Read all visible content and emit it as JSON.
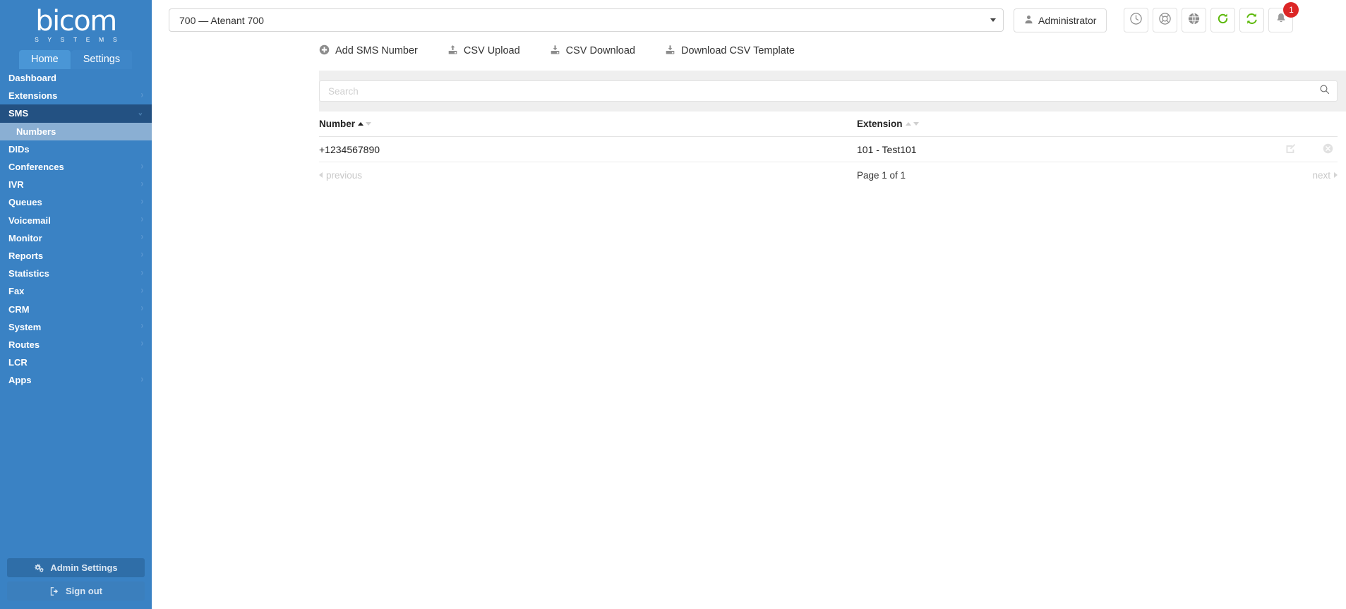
{
  "brand": {
    "logo_word": "bicom",
    "logo_sub": "S Y S T E M S",
    "sidebar_color": "#3a82c4",
    "accent_color": "#235182",
    "badge_color": "#dc2626",
    "refresh_green": "#5cb80a"
  },
  "tabs": [
    {
      "label": "Home",
      "active": true
    },
    {
      "label": "Settings",
      "active": false
    }
  ],
  "sidebar": {
    "items": [
      {
        "label": "Dashboard",
        "chevron": false,
        "state": "normal"
      },
      {
        "label": "Extensions",
        "chevron": true,
        "state": "normal"
      },
      {
        "label": "SMS",
        "chevron": true,
        "state": "expanded"
      },
      {
        "label": "Numbers",
        "chevron": false,
        "state": "sub-selected"
      },
      {
        "label": "DIDs",
        "chevron": false,
        "state": "normal"
      },
      {
        "label": "Conferences",
        "chevron": true,
        "state": "normal"
      },
      {
        "label": "IVR",
        "chevron": true,
        "state": "normal"
      },
      {
        "label": "Queues",
        "chevron": true,
        "state": "normal"
      },
      {
        "label": "Voicemail",
        "chevron": true,
        "state": "normal"
      },
      {
        "label": "Monitor",
        "chevron": true,
        "state": "normal"
      },
      {
        "label": "Reports",
        "chevron": true,
        "state": "normal"
      },
      {
        "label": "Statistics",
        "chevron": true,
        "state": "normal"
      },
      {
        "label": "Fax",
        "chevron": true,
        "state": "normal"
      },
      {
        "label": "CRM",
        "chevron": true,
        "state": "normal"
      },
      {
        "label": "System",
        "chevron": true,
        "state": "normal"
      },
      {
        "label": "Routes",
        "chevron": true,
        "state": "normal"
      },
      {
        "label": "LCR",
        "chevron": false,
        "state": "normal"
      },
      {
        "label": "Apps",
        "chevron": true,
        "state": "normal"
      }
    ],
    "admin_settings_label": "Admin Settings",
    "sign_out_label": "Sign out"
  },
  "topbar": {
    "tenant_value": "700 — Atenant 700",
    "user_label": "Administrator",
    "icons": [
      {
        "name": "clock-icon"
      },
      {
        "name": "lifebuoy-icon"
      },
      {
        "name": "globe-icon"
      },
      {
        "name": "reload-icon"
      },
      {
        "name": "sync-icon"
      },
      {
        "name": "bell-icon"
      }
    ],
    "notification_count": "1"
  },
  "toolbar": {
    "actions": [
      {
        "label": "Add SMS Number",
        "icon": "plus-circle-icon"
      },
      {
        "label": "CSV Upload",
        "icon": "upload-icon"
      },
      {
        "label": "CSV Download",
        "icon": "download-icon"
      },
      {
        "label": "Download CSV Template",
        "icon": "download-icon"
      }
    ]
  },
  "search": {
    "placeholder": "Search",
    "value": ""
  },
  "table": {
    "columns": [
      {
        "label": "Number",
        "sort": "asc"
      },
      {
        "label": "Extension",
        "sort": "none"
      }
    ],
    "rows": [
      {
        "number": "+1234567890",
        "extension": "101 - Test101"
      }
    ]
  },
  "pagination": {
    "previous_label": "previous",
    "page_label": "Page 1 of 1",
    "next_label": "next"
  }
}
